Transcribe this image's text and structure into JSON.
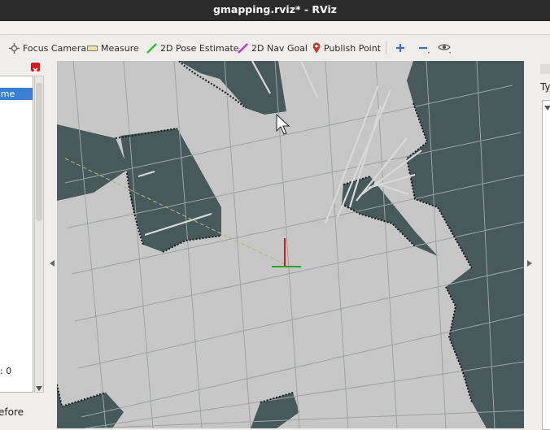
{
  "window": {
    "title": "gmapping.rviz* - RViz"
  },
  "toolbar": {
    "focus_camera": "Focus Camera",
    "measure": "Measure",
    "pose_estimate": "2D Pose Estimate",
    "nav_goal": "2D Nav Goal",
    "publish_point": "Publish Point",
    "icons": [
      "focus-camera-icon",
      "measure-icon",
      "pose-estimate-icon",
      "nav-goal-icon",
      "publish-point-icon",
      "zoom-in-icon",
      "zoom-out-icon",
      "eye-icon"
    ]
  },
  "displays_panel": {
    "selected_item": "ame",
    "status_text": ": 0",
    "bottom_text": "efore"
  },
  "right_panel": {
    "label": "Ty"
  },
  "colors": {
    "occupied": "#47595b",
    "free": "#c6c6c6",
    "grid": "#9aa0a0",
    "selection": "#3a7fd0",
    "titlebar": "#2b2b2b"
  }
}
